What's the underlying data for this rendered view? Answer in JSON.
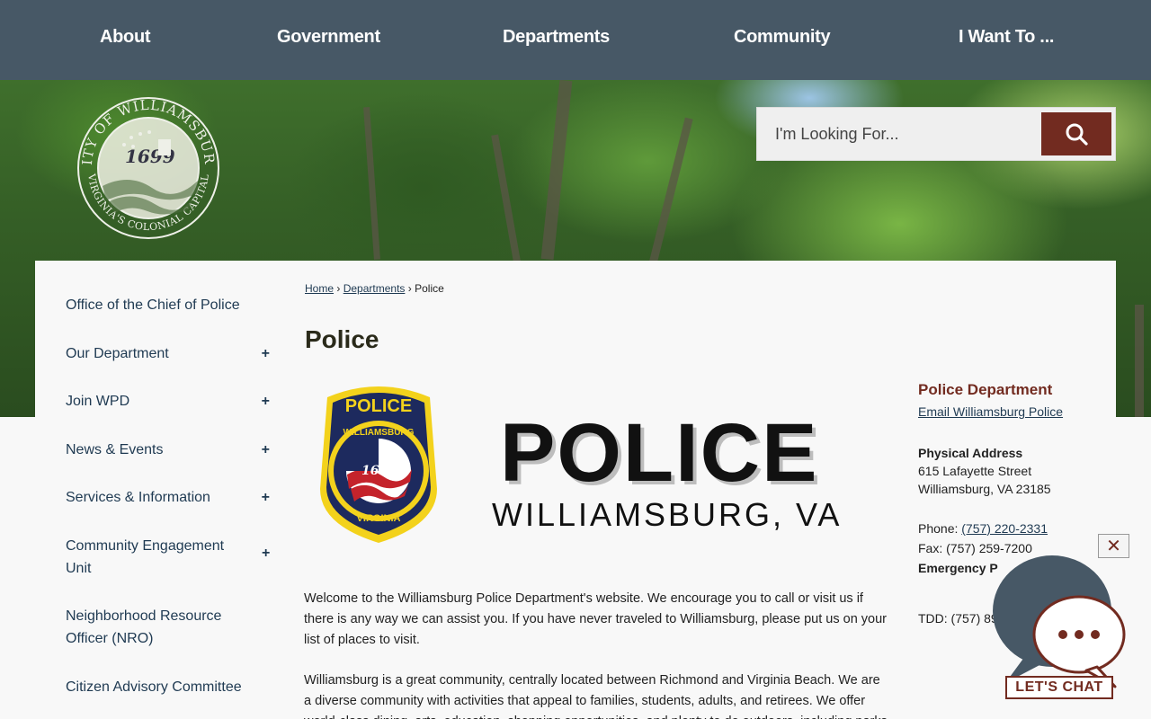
{
  "nav": {
    "items": [
      "About",
      "Government",
      "Departments",
      "Community",
      "I Want To ..."
    ]
  },
  "seal": {
    "ring_top": "CITY OF WILLIAMSBURG",
    "ring_bottom": "VIRGINIA'S COLONIAL CAPITAL",
    "year": "1699"
  },
  "search": {
    "placeholder": "I'm Looking For..."
  },
  "sidebar": {
    "items": [
      {
        "label": "Office of the Chief of Police",
        "expandable": false
      },
      {
        "label": "Our Department",
        "expandable": true
      },
      {
        "label": "Join WPD",
        "expandable": true
      },
      {
        "label": "News & Events",
        "expandable": true
      },
      {
        "label": "Services & Information",
        "expandable": true
      },
      {
        "label": "Community Engagement Unit",
        "expandable": true
      },
      {
        "label": "Neighborhood Resource Officer (NRO)",
        "expandable": false
      },
      {
        "label": "Citizen Advisory Committee",
        "expandable": false
      }
    ],
    "plus": "+"
  },
  "breadcrumb": {
    "home": "Home",
    "departments": "Departments",
    "current": "Police",
    "sep": "›"
  },
  "page": {
    "title": "Police"
  },
  "banner": {
    "badge_top": "POLICE",
    "badge_city": "WILLIAMSBURG",
    "badge_year": "1699",
    "badge_state": "VIRGINIA",
    "headline": "POLICE",
    "subline": "WILLIAMSBURG, VA"
  },
  "content": {
    "paragraph1": "Welcome to the Williamsburg Police Department's website. We encourage you to call or visit us if there is any way we can assist you. If you have never traveled to Williamsburg, please put us on your list of places to visit.",
    "paragraph2": "Williamsburg is a great community, centrally located between Richmond and Virginia Beach. We are a diverse community with activities that appeal to families, students, adults, and retirees. We offer world-class dining, arts, education, shopping opportunities, and plenty to do outdoors, including parks"
  },
  "contact": {
    "department": "Police Department",
    "email_link": "Email Williamsburg Police",
    "address_label": "Physical Address",
    "street": "615 Lafayette Street",
    "city": "Williamsburg, VA 23185",
    "phone_label": "Phone:",
    "phone": "(757) 220-2331",
    "fax": "Fax: (757) 259-7200",
    "emergency_label": "Emergency P",
    "tdd": "TDD: (757) 890-3"
  },
  "chat": {
    "close": "✕",
    "label": "LET'S CHAT"
  },
  "colors": {
    "nav_bg": "#475866",
    "accent": "#722b20",
    "link": "#1f3a52"
  }
}
